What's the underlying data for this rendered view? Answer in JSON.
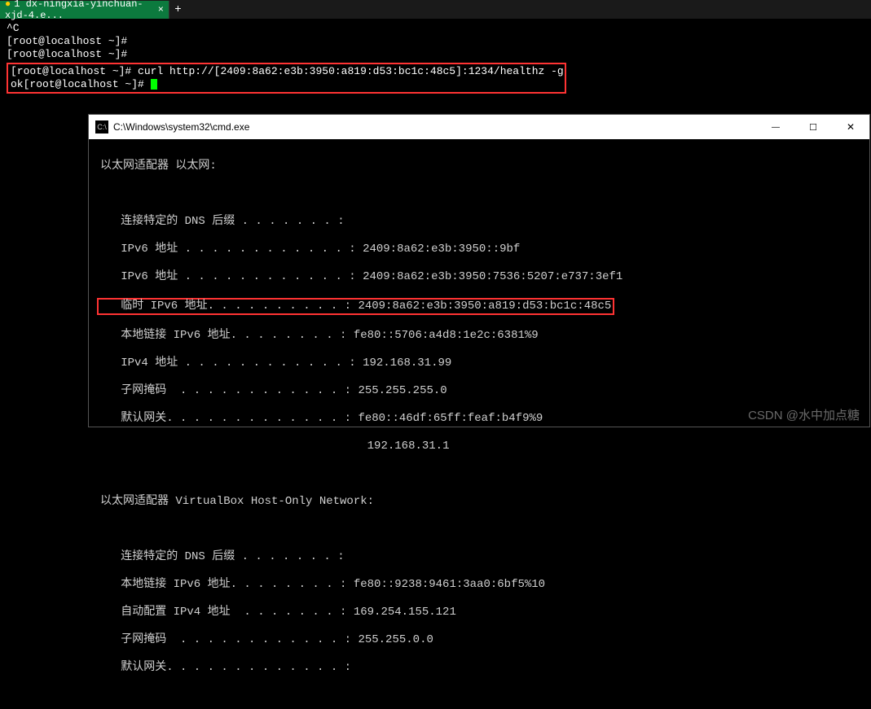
{
  "tab": {
    "label": "1 dx-ningxia-yinchuan-xjd-4.e..."
  },
  "terminal_top": {
    "line1": "^C",
    "prompt": "[root@localhost ~]#",
    "cmd": " curl http://[2409:8a62:e3b:3950:a819:d53:bc1c:48c5]:1234/healthz -g",
    "response": "ok"
  },
  "cmd_window": {
    "title": "C:\\Windows\\system32\\cmd.exe",
    "adapter1_header": "以太网适配器 以太网:",
    "adapter1": {
      "dns_suffix_label": "   连接特定的 DNS 后缀 . . . . . . . :",
      "ipv6_label": "   IPv6 地址 . . . . . . . . . . . . : ",
      "ipv6_value": "2409:8a62:e3b:3950::9bf",
      "ipv6b_label": "   IPv6 地址 . . . . . . . . . . . . : ",
      "ipv6b_value": "2409:8a62:e3b:3950:7536:5207:e737:3ef1",
      "temp_ipv6_label": "   临时 IPv6 地址. . . . . . . . . . : ",
      "temp_ipv6_value": "2409:8a62:e3b:3950:a819:d53:bc1c:48c5",
      "link_ipv6_label": "   本地链接 IPv6 地址. . . . . . . . : ",
      "link_ipv6_value": "fe80::5706:a4d8:1e2c:6381%9",
      "ipv4_label": "   IPv4 地址 . . . . . . . . . . . . : ",
      "ipv4_value": "192.168.31.99",
      "mask_label": "   子网掩码  . . . . . . . . . . . . : ",
      "mask_value": "255.255.255.0",
      "gw_label": "   默认网关. . . . . . . . . . . . . : ",
      "gw_value": "fe80::46df:65ff:feaf:b4f9%9",
      "gw_value2_pad": "                                       ",
      "gw_value2": "192.168.31.1"
    },
    "adapter2_header": "以太网适配器 VirtualBox Host-Only Network:",
    "adapter2": {
      "dns_suffix_label": "   连接特定的 DNS 后缀 . . . . . . . :",
      "link_ipv6_label": "   本地链接 IPv6 地址. . . . . . . . : ",
      "link_ipv6_value": "fe80::9238:9461:3aa0:6bf5%10",
      "auto_ipv4_label": "   自动配置 IPv4 地址  . . . . . . . : ",
      "auto_ipv4_value": "169.254.155.121",
      "mask_label": "   子网掩码  . . . . . . . . . . . . : ",
      "mask_value": "255.255.0.0",
      "gw_label": "   默认网关. . . . . . . . . . . . . :"
    }
  },
  "watermark": "CSDN @水中加点糖"
}
